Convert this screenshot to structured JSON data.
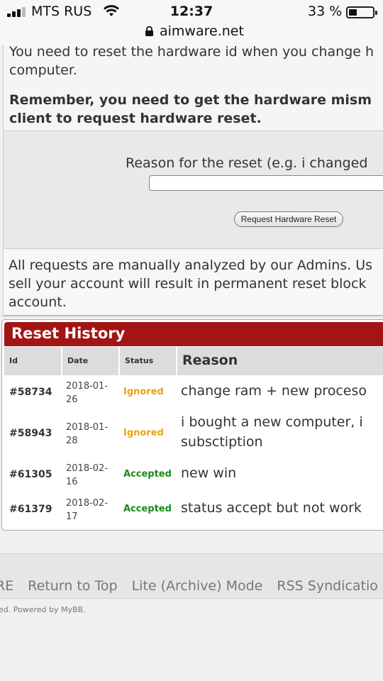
{
  "status_bar": {
    "carrier": "MTS RUS",
    "time": "12:37",
    "battery": "33 %",
    "battery_level": 0.33,
    "url": "aimware.net",
    "icons": [
      "signal-icon",
      "wifi-icon",
      "battery-icon",
      "lock-icon"
    ]
  },
  "info": {
    "line1": "You need to reset the hardware id when you change h",
    "line2": "computer.",
    "bold_line1": "Remember, you need to get the hardware mism",
    "bold_line2": "client to request hardware reset."
  },
  "form": {
    "reason_label": "Reason for the reset (e.g. i changed",
    "reason_value": "",
    "button_label": "Request Hardware Reset"
  },
  "notice": {
    "text": "All requests are manually analyzed by our Admins. Us\nsell your account will result in permanent reset block\naccount."
  },
  "history": {
    "title": "Reset History",
    "columns": [
      "Id",
      "Date",
      "Status",
      "Reason"
    ],
    "rows": [
      {
        "id": "#58734",
        "date": "2018-01-\n26",
        "status": "Ignored",
        "reason": "change ram + new proceso"
      },
      {
        "id": "#58943",
        "date": "2018-01-\n28",
        "status": "Ignored",
        "reason": "i bought a new computer, i\nsubsctiption"
      },
      {
        "id": "#61305",
        "date": "2018-02-\n16",
        "status": "Accepted",
        "reason": "new win"
      },
      {
        "id": "#61379",
        "date": "2018-02-\n17",
        "status": "Accepted",
        "reason": "status accept but not work"
      }
    ]
  },
  "colors": {
    "header_red": "#a31515",
    "ignored": "#e8a317",
    "accepted": "#1a8a1a"
  },
  "footer": {
    "links": [
      "RE",
      "Return to Top",
      "Lite (Archive) Mode",
      "RSS Syndicatio"
    ],
    "copyright": "ed. Powered by MyBB."
  }
}
